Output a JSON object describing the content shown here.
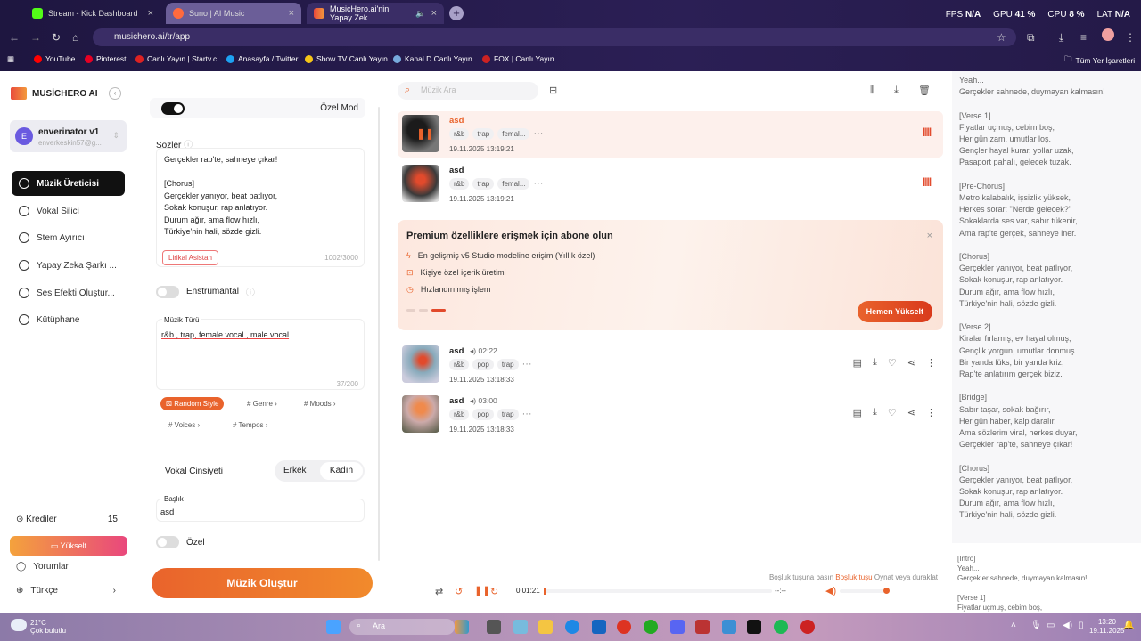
{
  "browser": {
    "tabs": [
      {
        "label": "Stream - Kick Dashboard"
      },
      {
        "label": "Suno | AI Music"
      },
      {
        "label": "MusicHero.ai'nin Yapay Zek..."
      }
    ],
    "stats": {
      "fps_label": "FPS",
      "fps": "N/A",
      "gpu_label": "GPU",
      "gpu": "41 %",
      "cpu_label": "CPU",
      "cpu": "8 %",
      "lat_label": "LAT",
      "lat": "N/A"
    },
    "url": "musichero.ai/tr/app",
    "bookmarks": [
      "YouTube",
      "Pinterest",
      "Canlı Yayın | Startv.c...",
      "Anasayfa / Twitter",
      "Show TV Canlı Yayın",
      "Kanal D Canlı Yayın...",
      "FOX | Canlı Yayın",
      "Tüm Yer İşaretleri"
    ]
  },
  "sidebar": {
    "brand": "MUSİCHERO AI",
    "user": {
      "initial": "E",
      "name": "enverinator v1",
      "email": "enverkeskin57@g..."
    },
    "items": [
      {
        "label": "Müzik Üreticisi"
      },
      {
        "label": "Vokal Silici"
      },
      {
        "label": "Stem Ayırıcı"
      },
      {
        "label": "Yapay Zeka Şarkı ..."
      },
      {
        "label": "Ses Efekti Oluştur..."
      },
      {
        "label": "Kütüphane"
      }
    ],
    "credits_label": "Krediler",
    "credits": "15",
    "upgrade": "Yükselt",
    "reviews": "Yorumlar",
    "language": "Türkçe"
  },
  "form": {
    "custom_mode": "Özel Mod",
    "lyrics_label": "Sözler",
    "lyrics": [
      "Gerçekler rap'te, sahneye çıkar!",
      "",
      "[Chorus]",
      "Gerçekler yanıyor, beat patlıyor,",
      "Sokak konuşur, rap anlatıyor.",
      "Durum ağır, ama flow hızlı,",
      "Türkiye'nin hali, sözde gizli."
    ],
    "lyrics_assistant": "Lirikal Asistan",
    "lyrics_count": "1002/3000",
    "instrumental": "Enstrümantal",
    "genre_label": "Müzik Türü",
    "genre_value": "r&b , trap, female vocal , male vocal",
    "genre_count": "37/200",
    "random_style": "Random Style",
    "chips": [
      "# Genre",
      "# Moods",
      "# Voices",
      "# Tempos"
    ],
    "vocal_gender": "Vokal Cinsiyeti",
    "male": "Erkek",
    "female": "Kadın",
    "title_label": "Başlık",
    "title_value": "asd",
    "private": "Özel",
    "create": "Müzik Oluştur"
  },
  "list": {
    "search_placeholder": "Müzik Ara",
    "songs": [
      {
        "title": "asd",
        "tags": [
          "r&b",
          "trap",
          "femal..."
        ],
        "date": "19.11.2025 13:19:21"
      },
      {
        "title": "asd",
        "tags": [
          "r&b",
          "trap",
          "femal..."
        ],
        "date": "19.11.2025 13:19:21"
      },
      {
        "title": "asd",
        "duration": "02:22",
        "tags": [
          "r&b",
          "pop",
          "trap"
        ],
        "date": "19.11.2025 13:18:33"
      },
      {
        "title": "asd",
        "duration": "03:00",
        "tags": [
          "r&b",
          "pop",
          "trap"
        ],
        "date": "19.11.2025 13:18:33"
      }
    ],
    "promo": {
      "title": "Premium özelliklere erişmek için abone olun",
      "features": [
        "En gelişmiş v5 Studio modeline erişim (Yıllık özel)",
        "Kişiye özel içerik üretimi",
        "Hızlandırılmış işlem"
      ],
      "cta": "Hemen Yükselt"
    }
  },
  "player": {
    "hint_pre": "Boşluk tuşuna basın",
    "hint_key": "Boşluk tuşu",
    "hint_post": "Oynat veya duraklat",
    "time": "0:01:21",
    "end": "--:--"
  },
  "lyrics_panel": [
    "Yeah...",
    "Gerçekler sahnede, duymayan kalmasın!",
    "",
    "[Verse 1]",
    "Fiyatlar uçmuş, cebim boş,",
    "Her gün zam, umutlar loş.",
    "Gençler hayal kurar, yollar uzak,",
    "Pasaport pahalı, gelecek tuzak.",
    "",
    "[Pre-Chorus]",
    "Metro kalabalık, işsizlik yüksek,",
    "Herkes sorar: \"Nerde gelecek?\"",
    "Sokaklarda ses var, sabır tükenir,",
    "Ama rap'te gerçek, sahneye iner.",
    "",
    "[Chorus]",
    "Gerçekler yanıyor, beat patlıyor,",
    "Sokak konuşur, rap anlatıyor.",
    "Durum ağır, ama flow hızlı,",
    "Türkiye'nin hali, sözde gizli.",
    "",
    "[Verse 2]",
    "Kiralar fırlamış, ev hayal olmuş,",
    "Gençlik yorgun, umutlar donmuş.",
    "Bir yanda lüks, bir yanda kriz,",
    "Rap'te anlatırım gerçek biziz.",
    "",
    "[Bridge]",
    "Sabır taşar, sokak bağırır,",
    "Her gün haber, kalp daralır.",
    "Ama sözlerim viral, herkes duyar,",
    "Gerçekler rap'te, sahneye çıkar!",
    "",
    "[Chorus]",
    "Gerçekler yanıyor, beat patlıyor,",
    "Sokak konuşur, rap anlatıyor.",
    "Durum ağır, ama flow hızlı,",
    "Türkiye'nin hali, sözde gizli."
  ],
  "lyrics_panel2": [
    "[Intro]",
    "Yeah...",
    "Gerçekler sahnede, duymayan kalmasın!",
    "",
    "[Verse 1]",
    "Fiyatlar uçmuş, cebim boş,"
  ],
  "taskbar": {
    "temp": "21°C",
    "weather": "Çok bulutlu",
    "search": "Ara",
    "time": "13:20",
    "date": "19.11.2025"
  },
  "colors": {
    "accent": "#e9632c",
    "dark": "#111111",
    "promo_bg": "#fde8df"
  }
}
